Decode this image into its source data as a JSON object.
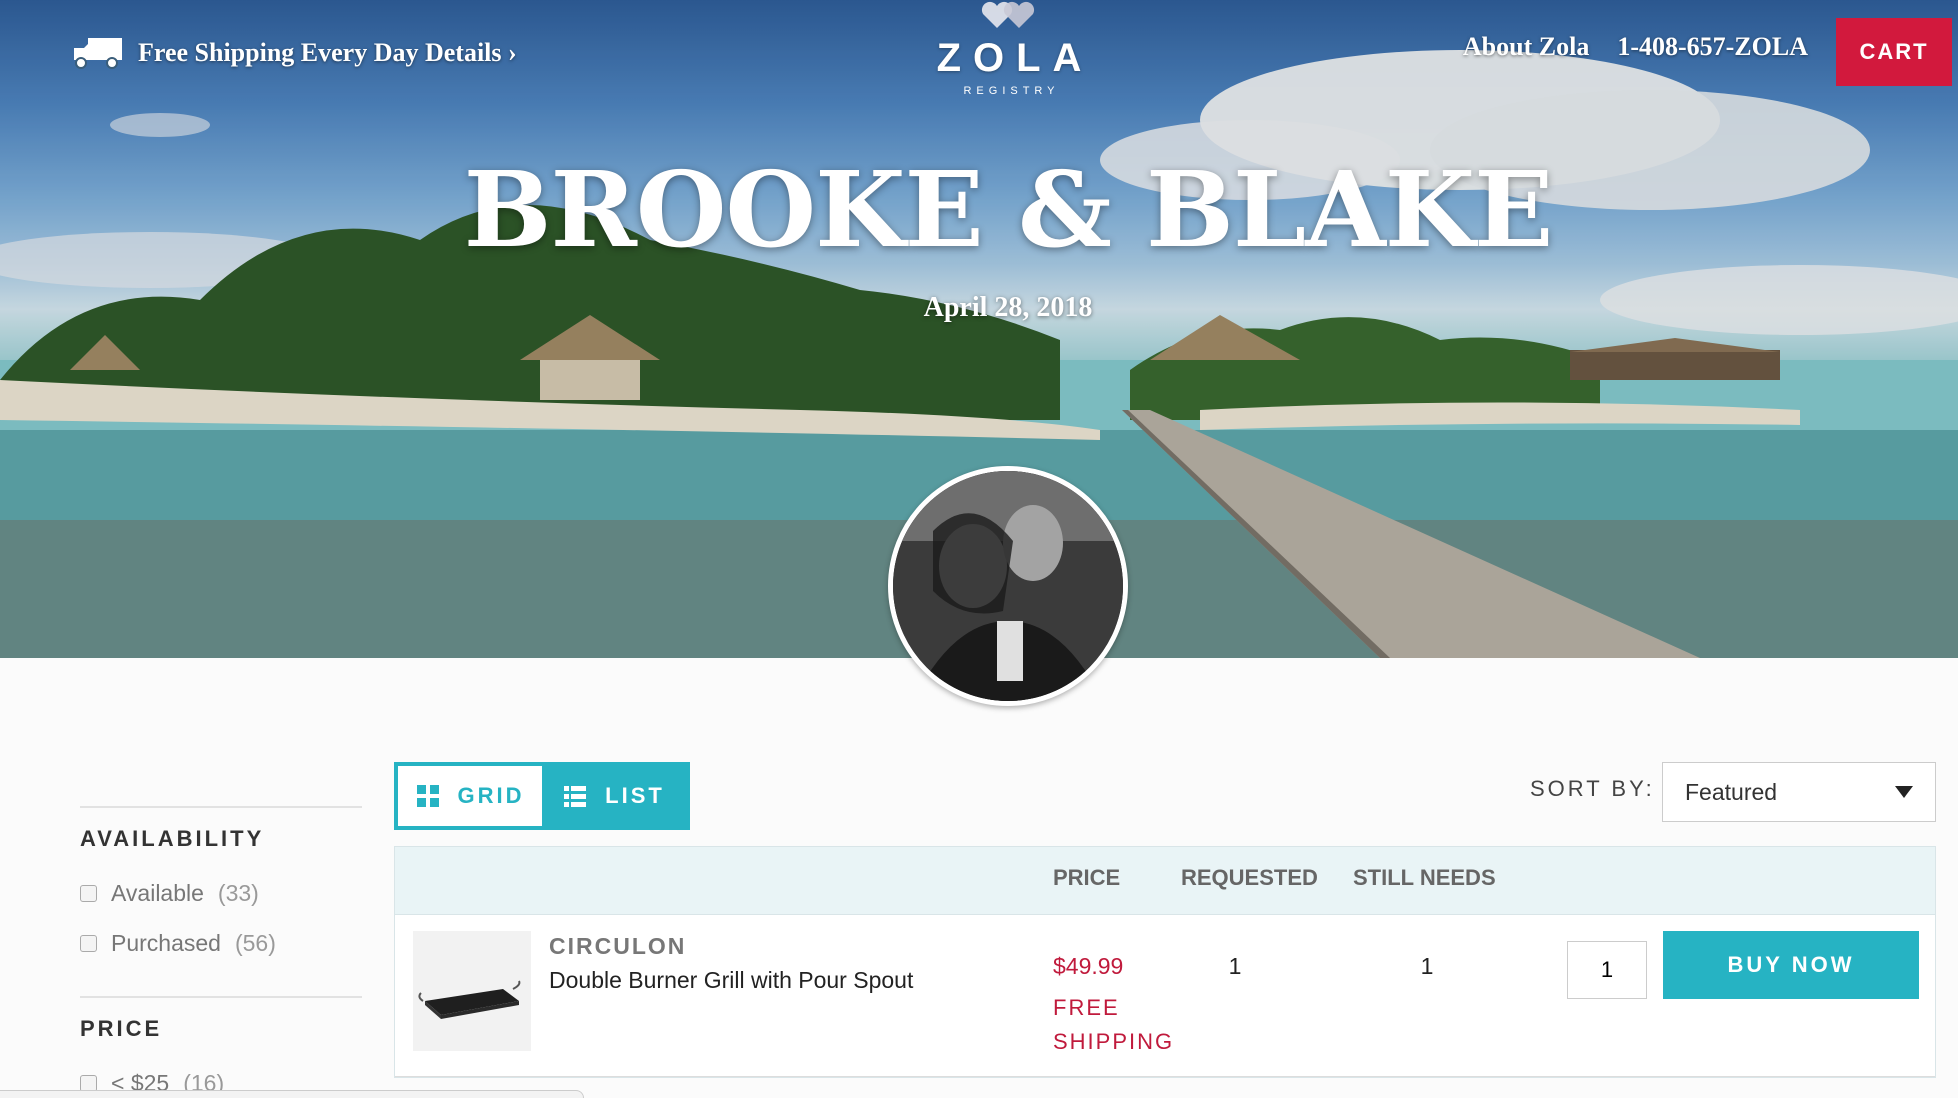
{
  "header": {
    "shipping_text": "Free Shipping Every Day Details ›",
    "logo_word": "ZOLA",
    "logo_sub": "REGISTRY",
    "nav": [
      {
        "label": "About Zola"
      },
      {
        "label": "1-408-657-ZOLA"
      }
    ],
    "cart_label": "CART"
  },
  "hero": {
    "title": "BROOKE & BLAKE",
    "date": "April 28, 2018"
  },
  "filters": [
    {
      "title": "AVAILABILITY",
      "options": [
        {
          "label": "Available",
          "count": "(33)"
        },
        {
          "label": "Purchased",
          "count": "(56)"
        }
      ]
    },
    {
      "title": "PRICE",
      "options": [
        {
          "label": "< $25",
          "count": "(16)"
        }
      ]
    }
  ],
  "view_toggle": {
    "grid_label": "GRID",
    "list_label": "LIST",
    "active": "list"
  },
  "sort": {
    "label": "SORT BY:",
    "selected": "Featured"
  },
  "table": {
    "headers": {
      "price": "PRICE",
      "requested": "REQUESTED",
      "still_needs": "STILL NEEDS"
    },
    "rows": [
      {
        "brand": "CIRCULON",
        "name": "Double Burner Grill with Pour Spout",
        "price": "$49.99",
        "shipping": "FREE SHIPPING",
        "requested": "1",
        "still_needs": "1",
        "quantity": "1",
        "buy_label": "BUY NOW"
      }
    ]
  },
  "colors": {
    "accent": "#26b3c3",
    "cart": "#d2193d",
    "price": "#c01a3c"
  },
  "icons": [
    "truck-icon",
    "hearts-logo-icon",
    "grid-icon",
    "list-icon",
    "caret-down-icon"
  ]
}
